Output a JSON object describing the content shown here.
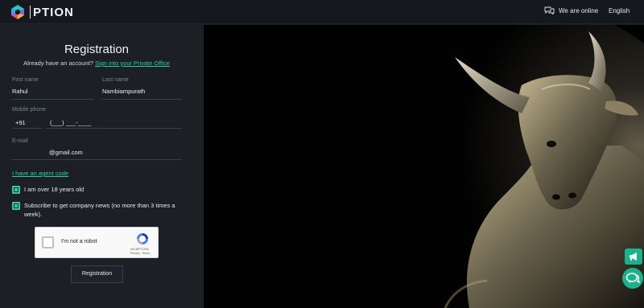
{
  "header": {
    "brand": "PTION",
    "online_label": "We are online",
    "language": "English"
  },
  "form": {
    "title": "Registration",
    "account_prompt": "Already have an account?",
    "signin_link": "Sign into your Private Office",
    "first_name": {
      "label": "First name",
      "value": "Rahul"
    },
    "last_name": {
      "label": "Last name",
      "value": "Nambiampurath"
    },
    "mobile": {
      "label": "Mobile phone",
      "code": "+91",
      "mask": "(___) ___-____"
    },
    "email": {
      "label": "E-mail",
      "value": "@gmail.com"
    },
    "agent_link": "I have an agent code",
    "age_check": {
      "label": "I am over 18 years old",
      "checked": true
    },
    "news_check": {
      "label": "Subscribe to get company news (no more than 3 times a week).",
      "checked": true
    },
    "captcha": {
      "label": "I'm not a robot",
      "brand": "reCAPTCHA",
      "terms": "Privacy - Terms"
    },
    "submit_label": "Registration"
  },
  "colors": {
    "accent": "#1fd19e",
    "panel": "#1c2025",
    "topbar": "#15191d"
  },
  "floating": {
    "icons": [
      "megaphone-icon",
      "chat-icon"
    ]
  }
}
